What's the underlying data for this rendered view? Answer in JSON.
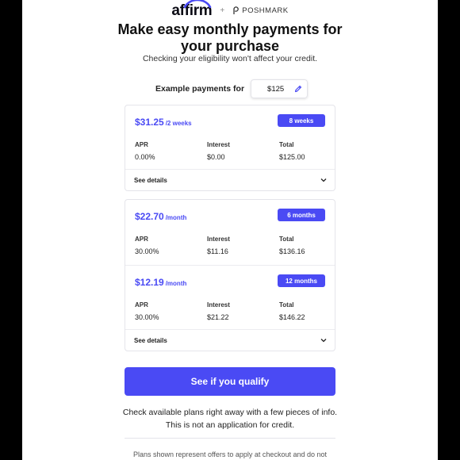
{
  "logos": {
    "affirm": "affirm",
    "plus": "+",
    "partner": "POSHMARK"
  },
  "headline": {
    "line1": "Make easy monthly payments for",
    "line2": "your purchase"
  },
  "subhead": "Checking your eligibility won't affect your credit.",
  "example": {
    "label": "Example payments for",
    "amount": "$125",
    "edit_icon": "pencil-icon"
  },
  "plans": [
    {
      "price": "$31.25",
      "period": "/2 weeks",
      "term": "8 weeks",
      "apr_label": "APR",
      "apr": "0.00%",
      "interest_label": "Interest",
      "interest": "$0.00",
      "total_label": "Total",
      "total": "$125.00"
    },
    {
      "price": "$22.70",
      "period": "/month",
      "term": "6 months",
      "apr_label": "APR",
      "apr": "30.00%",
      "interest_label": "Interest",
      "interest": "$11.16",
      "total_label": "Total",
      "total": "$136.16"
    },
    {
      "price": "$12.19",
      "period": "/month",
      "term": "12 months",
      "apr_label": "APR",
      "apr": "30.00%",
      "interest_label": "Interest",
      "interest": "$21.22",
      "total_label": "Total",
      "total": "$146.22"
    }
  ],
  "see_details": "See details",
  "cta": "See if you qualify",
  "info": {
    "line1": "Check available plans right away with a few pieces of info.",
    "line2": "This is not an application for credit."
  },
  "footer": "Plans shown represent offers to apply at checkout and do not",
  "colors": {
    "accent": "#4a4af4",
    "text": "#1a1a1a",
    "border": "#e4e4ea"
  }
}
